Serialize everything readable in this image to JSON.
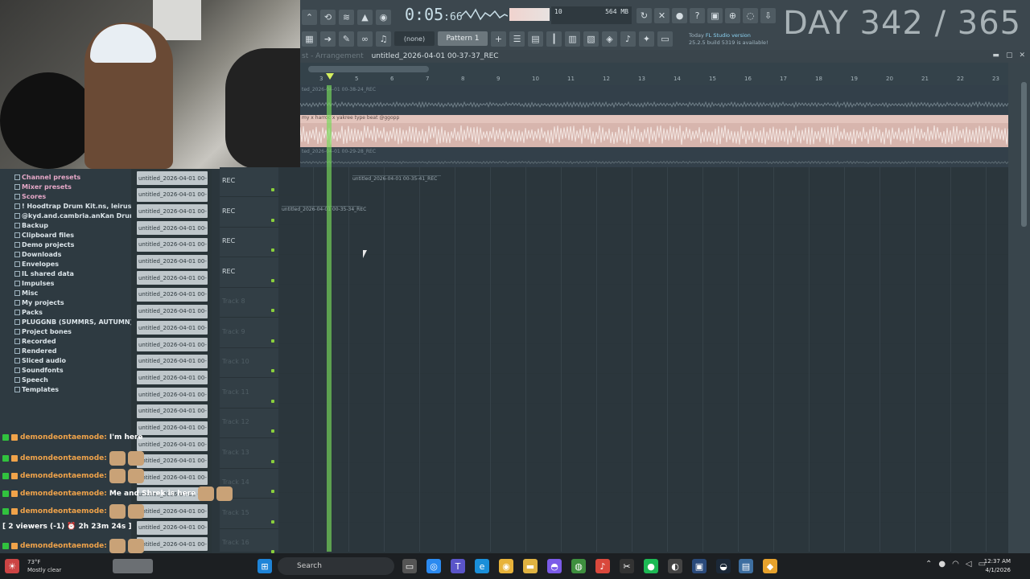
{
  "toolbar": {
    "time": "0:05",
    "time_frac": ":66",
    "cpu_left": "10",
    "cpu_right": "564 MB",
    "cpu_sub": "7",
    "pattern_none": "(none)",
    "pattern": "Pattern 1",
    "news_title": "FL Studio version",
    "news_line": "25.2.5 build 5319 is available!",
    "news_prefix": "Today"
  },
  "overlay": {
    "day_counter": "DAY 342 / 365"
  },
  "playlist": {
    "title_muted": "st - Arrangement",
    "title": "untitled_2026-04-01 00-37-37_REC",
    "ruler": [
      "3",
      "5",
      "6",
      "7",
      "8",
      "9",
      "10",
      "11",
      "12",
      "13",
      "14",
      "15",
      "16",
      "17",
      "18",
      "19",
      "20",
      "21",
      "22",
      "23"
    ],
    "lane1_label": "ted_2026-04-01 00-38-24_REC",
    "main_clip_label": "my x harroc x yakree type beat @ggopp",
    "lane2_label": "ted_2026-04-01 00-29-28_REC",
    "clip_a_label": "untitled_2026-04-01 00-35-41_REC",
    "clip_b_label": "untitled_2026-04-01 00-35-34_REC"
  },
  "tracks": [
    {
      "name": "REC",
      "dim": false
    },
    {
      "name": "REC",
      "dim": false
    },
    {
      "name": "REC",
      "dim": false
    },
    {
      "name": "REC",
      "dim": false
    },
    {
      "name": "Track 8",
      "dim": true
    },
    {
      "name": "Track 9",
      "dim": true
    },
    {
      "name": "Track 10",
      "dim": true
    },
    {
      "name": "Track 11",
      "dim": true
    },
    {
      "name": "Track 12",
      "dim": true
    },
    {
      "name": "Track 13",
      "dim": true
    },
    {
      "name": "Track 14",
      "dim": true
    },
    {
      "name": "Track 15",
      "dim": true
    },
    {
      "name": "Track 16",
      "dim": true
    }
  ],
  "browser": [
    {
      "label": "Channel presets",
      "pink": true
    },
    {
      "label": "Mixer presets",
      "pink": true
    },
    {
      "label": "Scores",
      "pink": true
    },
    {
      "label": "! Hoodtrap Drum Kit.ns, leirusu, jai) (2)",
      "pink": false
    },
    {
      "label": "@kyd.and.cambria.anKan DrumaLoopKit",
      "pink": false
    },
    {
      "label": "Backup",
      "pink": false
    },
    {
      "label": "Clipboard files",
      "pink": false
    },
    {
      "label": "Demo projects",
      "pink": false
    },
    {
      "label": "Downloads",
      "pink": false
    },
    {
      "label": "Envelopes",
      "pink": false
    },
    {
      "label": "IL shared data",
      "pink": false
    },
    {
      "label": "Impulses",
      "pink": false
    },
    {
      "label": "Misc",
      "pink": false
    },
    {
      "label": "My projects",
      "pink": false
    },
    {
      "label": "Packs",
      "pink": false
    },
    {
      "label": "PLUGGNB (SUMMRS, AUTUMN) DRUMKIT",
      "pink": false
    },
    {
      "label": "Project bones",
      "pink": false
    },
    {
      "label": "Recorded",
      "pink": false
    },
    {
      "label": "Rendered",
      "pink": false
    },
    {
      "label": "Sliced audio",
      "pink": false
    },
    {
      "label": "Soundfonts",
      "pink": false
    },
    {
      "label": "Speech",
      "pink": false
    },
    {
      "label": "Templates",
      "pink": false
    }
  ],
  "recordings_label": "untitled_2026-04-01 00-",
  "chat": [
    {
      "user": "demondeontaemode:",
      "msg": "I'm here",
      "emotes": 0
    },
    {
      "user": "demondeontaemode:",
      "msg": "",
      "emotes": 2
    },
    {
      "user": "demondeontaemode:",
      "msg": "",
      "emotes": 2
    },
    {
      "user": "demondeontaemode:",
      "msg": "Me and Shrek is here",
      "emotes": 2
    },
    {
      "user": "demondeontaemode:",
      "msg": "",
      "emotes": 2
    }
  ],
  "chat_status": {
    "viewers": "[ 2 viewers (-1) ",
    "time": "2h 23m 24s ]"
  },
  "chat_last": {
    "user": "demondeontaemode:",
    "emotes": 2
  },
  "taskbar": {
    "search": "Search",
    "weather_temp": "73°F",
    "weather_desc": "Mostly clear",
    "time": "12:37 AM",
    "date": "4/1/2026"
  }
}
